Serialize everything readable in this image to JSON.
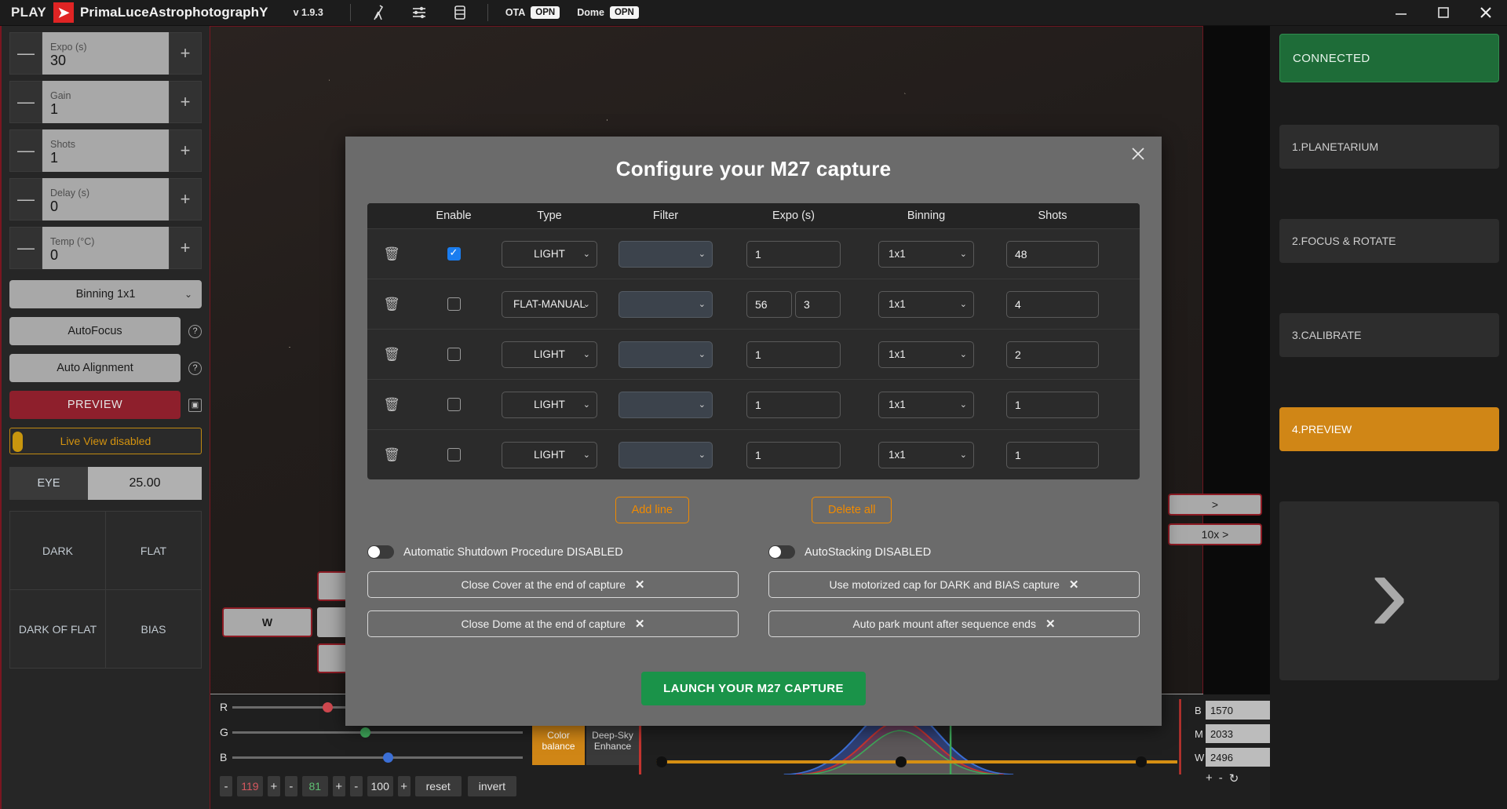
{
  "titlebar": {
    "play": "PLAY",
    "logo_icon": "primaluce-logo-icon",
    "brand": "PrimaLuceAstrophotographY",
    "version": "v 1.9.3",
    "telescope_icon": "telescope-icon",
    "sliders_icon": "sliders-icon",
    "panel_icon": "panel-icon",
    "ota_label": "OTA",
    "ota_state": "OPN",
    "dome_label": "Dome",
    "dome_state": "OPN",
    "minimize": "—",
    "maximize": "▢",
    "close": "✕"
  },
  "left": {
    "steppers": [
      {
        "label": "Expo (s)",
        "value": "30",
        "minus": "—",
        "plus": "+"
      },
      {
        "label": "Gain",
        "value": "1",
        "minus": "—",
        "plus": "+"
      },
      {
        "label": "Shots",
        "value": "1",
        "minus": "—",
        "plus": "+"
      },
      {
        "label": "Delay (s)",
        "value": "0",
        "minus": "—",
        "plus": "+"
      },
      {
        "label": "Temp (°C)",
        "value": "0",
        "minus": "—",
        "plus": "+"
      }
    ],
    "binning": "Binning 1x1",
    "autofocus": "AutoFocus",
    "auto_alignment": "Auto Alignment",
    "preview": "PREVIEW",
    "live_view": "Live View disabled",
    "eye_label": "EYE",
    "eye_value": "25.00",
    "cal_cells": [
      "DARK",
      "FLAT",
      "DARK OF FLAT",
      "BIAS"
    ],
    "help_icon": "question-mark-icon",
    "screenshot_icon": "screenshot-icon"
  },
  "image_area": {
    "nav_w": "W",
    "zoom_buttons": [
      ">",
      "10x >"
    ]
  },
  "bottom": {
    "channels": [
      {
        "name": "R",
        "value": "119",
        "color": "#d0484f",
        "pos": 31
      },
      {
        "name": "G",
        "value": "81",
        "color": "#3fa85a",
        "pos": 44
      },
      {
        "name": "B",
        "value": "100",
        "color": "#3b6fd6",
        "pos": 52
      }
    ],
    "minus": "-",
    "plus": "+",
    "reset": "reset",
    "invert": "invert",
    "color_balance": "Color balance",
    "deep_sky": "Deep-Sky Enhance",
    "levels": [
      {
        "key": "B",
        "value": "1570"
      },
      {
        "key": "M",
        "value": "2033"
      },
      {
        "key": "W",
        "value": "2496"
      }
    ],
    "level_buttons": [
      "+",
      "-",
      "↻"
    ]
  },
  "right": {
    "status": "CONNECTED",
    "steps": [
      {
        "label": "1.PLANETARIUM",
        "active": false
      },
      {
        "label": "2.FOCUS & ROTATE",
        "active": false
      },
      {
        "label": "3.CALIBRATE",
        "active": false
      },
      {
        "label": "4.PREVIEW",
        "active": true
      }
    ],
    "preview_glyph": "›"
  },
  "modal": {
    "title": "Configure your M27 capture",
    "close_icon": "close-icon",
    "columns": [
      "Enable",
      "Type",
      "Filter",
      "Expo (s)",
      "Binning",
      "Shots"
    ],
    "rows": [
      {
        "delete_icon": "trash-icon",
        "enabled": true,
        "type": "LIGHT",
        "filter": "",
        "expo": "1",
        "expo2": "",
        "binning": "1x1",
        "shots": "48"
      },
      {
        "delete_icon": "trash-icon",
        "enabled": false,
        "type": "FLAT-MANUAL",
        "filter": "",
        "expo": "56",
        "expo2": "3",
        "binning": "1x1",
        "shots": "4"
      },
      {
        "delete_icon": "trash-icon",
        "enabled": false,
        "type": "LIGHT",
        "filter": "",
        "expo": "1",
        "expo2": "",
        "binning": "1x1",
        "shots": "2"
      },
      {
        "delete_icon": "trash-icon",
        "enabled": false,
        "type": "LIGHT",
        "filter": "",
        "expo": "1",
        "expo2": "",
        "binning": "1x1",
        "shots": "1"
      },
      {
        "delete_icon": "trash-icon",
        "enabled": false,
        "type": "LIGHT",
        "filter": "",
        "expo": "1",
        "expo2": "",
        "binning": "1x1",
        "shots": "1"
      }
    ],
    "add_line": "Add line",
    "delete_all": "Delete all",
    "toggle_left": "Automatic Shutdown Procedure DISABLED",
    "toggle_right": "AutoStacking DISABLED",
    "opt_close_cover": "Close Cover at the end of capture",
    "opt_close_dome": "Close Dome at the end of capture",
    "opt_motorized_cap": "Use motorized cap for DARK and BIAS capture",
    "opt_auto_park": "Auto park mount after sequence ends",
    "opt_x": "✕",
    "launch": "LAUNCH YOUR M27 CAPTURE",
    "accent_orange": "#f08a00",
    "accent_green": "#1a9349"
  }
}
